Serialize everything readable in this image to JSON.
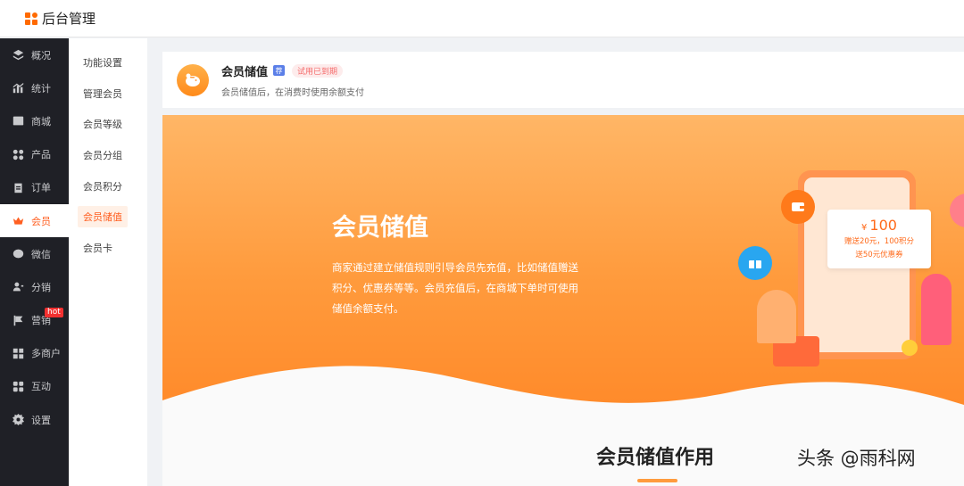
{
  "app": {
    "title": "后台管理"
  },
  "sidebar": {
    "items": [
      {
        "label": "概况",
        "icon": "layers-icon",
        "active": false
      },
      {
        "label": "统计",
        "icon": "chart-icon",
        "active": false
      },
      {
        "label": "商城",
        "icon": "mail-icon",
        "active": false
      },
      {
        "label": "产品",
        "icon": "grid-icon",
        "active": false
      },
      {
        "label": "订单",
        "icon": "clipboard-icon",
        "active": false
      },
      {
        "label": "会员",
        "icon": "crown-icon",
        "active": true
      },
      {
        "label": "微信",
        "icon": "wechat-icon",
        "active": false
      },
      {
        "label": "分销",
        "icon": "user-share-icon",
        "active": false
      },
      {
        "label": "营销",
        "icon": "flag-icon",
        "active": false,
        "badge": "hot"
      },
      {
        "label": "多商户",
        "icon": "store-icon",
        "active": false
      },
      {
        "label": "互动",
        "icon": "apps-icon",
        "active": false
      },
      {
        "label": "设置",
        "icon": "gear-icon",
        "active": false
      }
    ]
  },
  "subnav": {
    "items": [
      {
        "label": "功能设置",
        "active": false
      },
      {
        "label": "管理会员",
        "active": false
      },
      {
        "label": "会员等级",
        "active": false
      },
      {
        "label": "会员分组",
        "active": false
      },
      {
        "label": "会员积分",
        "active": false
      },
      {
        "label": "会员储值",
        "active": true
      },
      {
        "label": "会员卡",
        "active": false
      }
    ]
  },
  "header": {
    "title": "会员储值",
    "tag": "荐",
    "badge": "试用已到期",
    "desc": "会员储值后，在消费时使用余额支付"
  },
  "banner": {
    "title": "会员储值",
    "desc": "商家通过建立储值规则引导会员先充值，比如储值赠送积分、优惠券等等。会员充值后，在商城下单时可使用储值余额支付。",
    "price_currency": "¥",
    "price_value": "100",
    "price_note_1": "赠送20元，100积分",
    "price_note_2": "送50元优惠券"
  },
  "section": {
    "title": "会员储值作用"
  },
  "watermark": "头条 @雨科网",
  "colors": {
    "accent": "#ff5f21",
    "sidebar_bg": "#1f2026",
    "banner_orange": "#ff9b3d"
  }
}
